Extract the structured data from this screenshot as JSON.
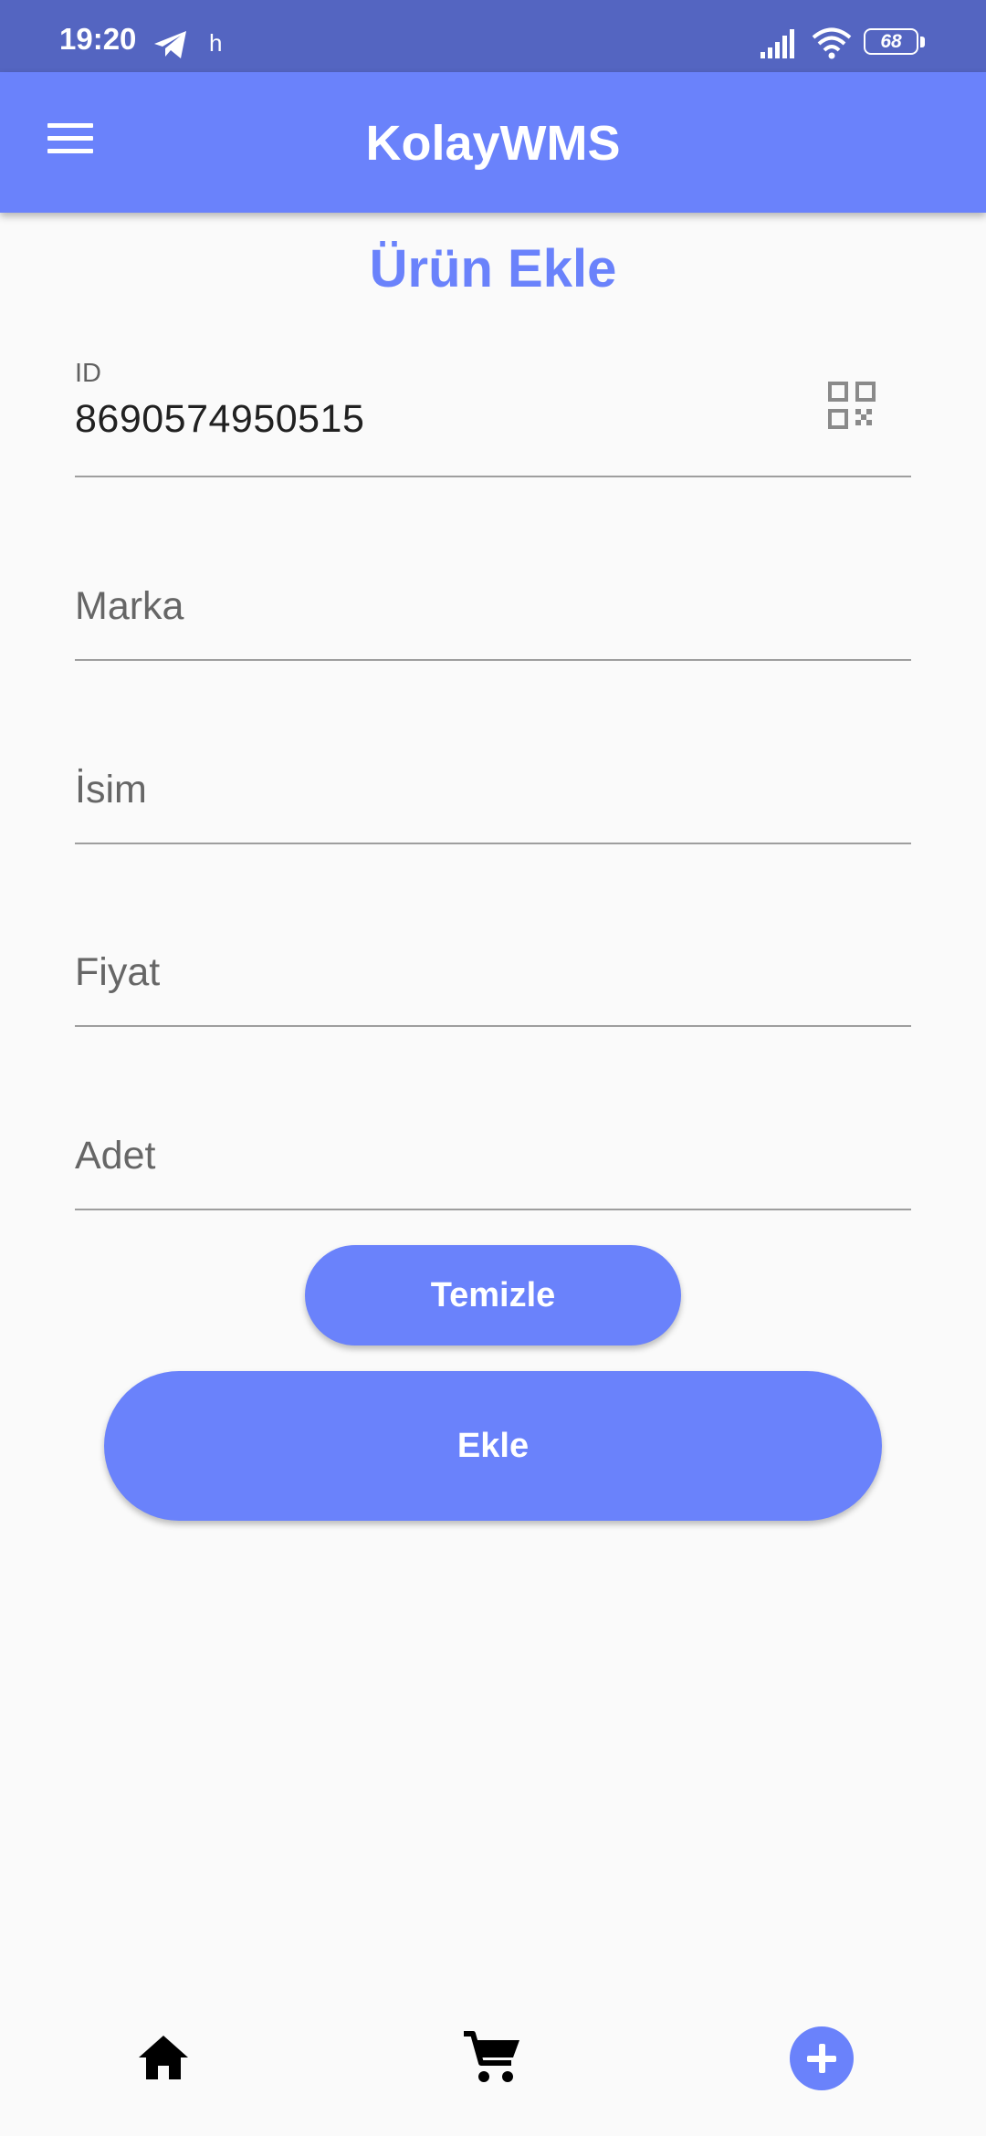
{
  "status_bar": {
    "time": "19:20",
    "notification_letter": "h",
    "battery_level": "68",
    "icons": [
      "telegram-icon",
      "signal-icon",
      "wifi-icon",
      "battery-icon"
    ]
  },
  "app_bar": {
    "title": "KolayWMS",
    "menu_icon": "menu-icon"
  },
  "page": {
    "title": "Ürün Ekle"
  },
  "form": {
    "id_field": {
      "label": "ID",
      "value": "8690574950515",
      "action_icon": "qr-code-icon"
    },
    "brand_field": {
      "placeholder": "Marka"
    },
    "name_field": {
      "placeholder": "İsim"
    },
    "price_field": {
      "placeholder": "Fiyat"
    },
    "quantity_field": {
      "placeholder": "Adet"
    }
  },
  "buttons": {
    "clear_label": "Temizle",
    "add_label": "Ekle"
  },
  "bottom_nav": {
    "items": [
      {
        "icon": "home-icon"
      },
      {
        "icon": "cart-icon"
      },
      {
        "icon": "add-circle-icon",
        "active": true
      }
    ]
  },
  "colors": {
    "primary": "#6a82fb",
    "status_bar": "#5465c1",
    "background": "#fafafa",
    "underline": "#9e9e9e"
  }
}
